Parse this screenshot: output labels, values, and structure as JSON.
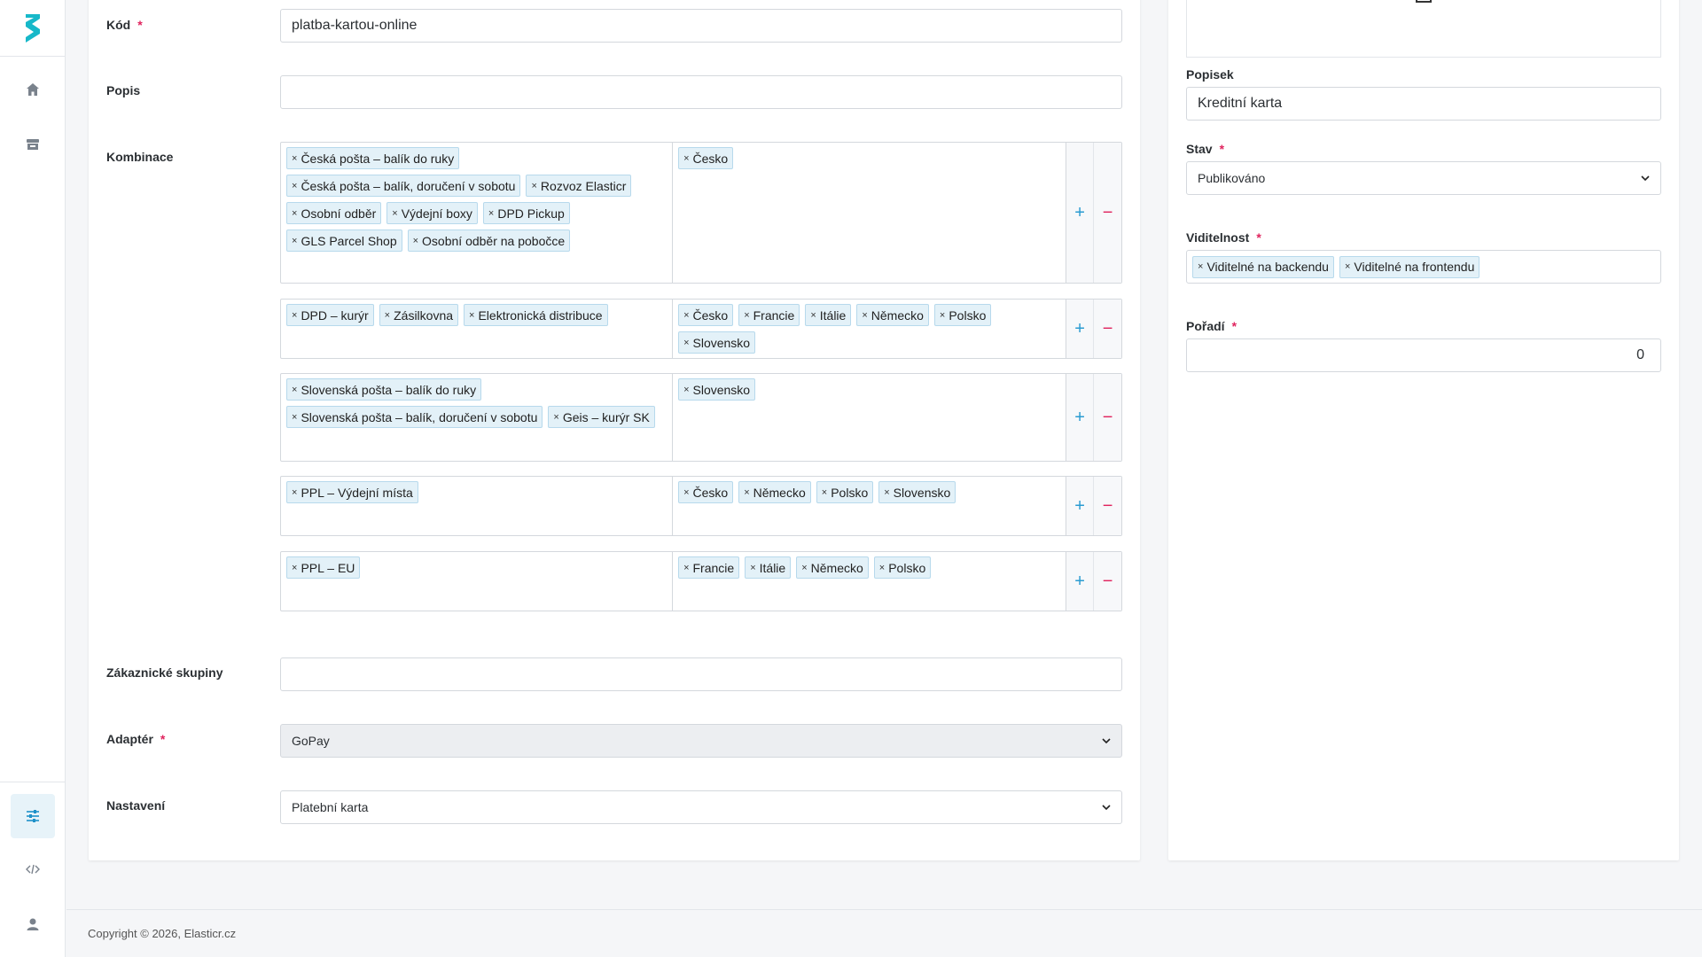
{
  "sidebar": {
    "items": [
      {
        "name": "home-icon"
      },
      {
        "name": "store-icon"
      },
      {
        "name": "settings-sliders-icon"
      },
      {
        "name": "code-icon"
      },
      {
        "name": "user-icon"
      }
    ],
    "accent": "#1e91c9"
  },
  "form": {
    "kod": {
      "label": "Kód",
      "value": "platba-kartou-online"
    },
    "popis": {
      "label": "Popis",
      "value": ""
    },
    "kombinace": {
      "label": "Kombinace",
      "rows": [
        {
          "left": [
            "Česká pošta – balík do ruky",
            "Česká pošta – balík, doručení v sobotu",
            "Rozvoz Elasticr",
            "Osobní odběr",
            "Výdejní boxy",
            "DPD Pickup",
            "GLS Parcel Shop",
            "Osobní odběr na pobočce"
          ],
          "right": [
            "Česko"
          ]
        },
        {
          "left": [
            "DPD – kurýr",
            "Zásilkovna",
            "Elektronická distribuce"
          ],
          "right": [
            "Česko",
            "Francie",
            "Itálie",
            "Německo",
            "Polsko",
            "Slovensko"
          ]
        },
        {
          "left": [
            "Slovenská pošta – balík do ruky",
            "Slovenská pošta – balík, doručení v sobotu",
            "Geis – kurýr SK"
          ],
          "right": [
            "Slovensko"
          ]
        },
        {
          "left": [
            "PPL – Výdejní místa"
          ],
          "right": [
            "Česko",
            "Německo",
            "Polsko",
            "Slovensko"
          ]
        },
        {
          "left": [
            "PPL – EU"
          ],
          "right": [
            "Francie",
            "Itálie",
            "Německo",
            "Polsko"
          ]
        }
      ],
      "add_symbol": "+",
      "remove_symbol": "−",
      "remove_tag_symbol": "×"
    },
    "zakaznicke_skupiny": {
      "label": "Zákaznické skupiny",
      "value": ""
    },
    "adapter": {
      "label": "Adaptér",
      "value": "GoPay"
    },
    "nastaveni": {
      "label": "Nastavení",
      "value": "Platební karta"
    },
    "required_mark": "*"
  },
  "side_panel": {
    "popisek": {
      "label": "Popisek",
      "value": "Kreditní karta"
    },
    "stav": {
      "label": "Stav",
      "value": "Publikováno"
    },
    "viditelnost": {
      "label": "Viditelnost",
      "values": [
        "Viditelné na backendu",
        "Viditelné na frontendu"
      ]
    },
    "poradi": {
      "label": "Pořadí",
      "value": "0"
    }
  },
  "footer": {
    "text": "Copyright © 2026, Elasticr.cz"
  }
}
